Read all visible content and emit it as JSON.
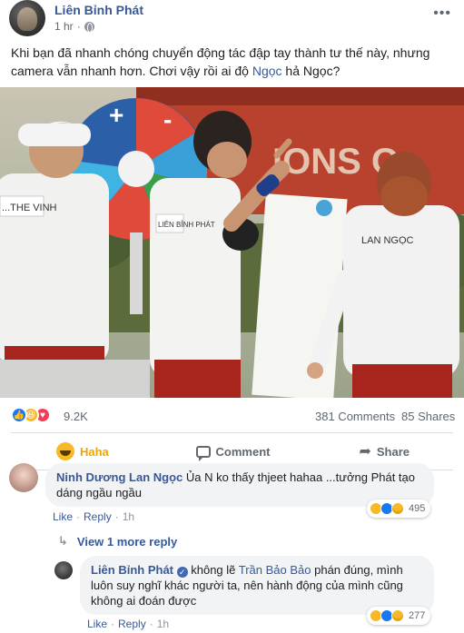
{
  "post": {
    "author": "Liên Bỉnh Phát",
    "time": "1 hr",
    "text_before_mention": "Khi bạn đã nhanh chóng chuyển động tác đập tay thành tư thế này, nhưng camera vẫn nhanh hơn. Chơi vậy rồi ai độ ",
    "mention": "Ngọc",
    "text_after_mention": " hả Ngọc?"
  },
  "photo": {
    "shirt_labels": [
      "...THE VINH",
      "LIÊN BỈNH PHÁT",
      "LAN NGỌC"
    ],
    "wall_text": "IONS O"
  },
  "stats": {
    "reactions": "9.2K",
    "comments": "381 Comments",
    "shares": "85 Shares"
  },
  "actions": {
    "haha": "Haha",
    "comment": "Comment",
    "share": "Share"
  },
  "comments": [
    {
      "author": "Ninh Dương Lan Ngọc",
      "text": "Ủa N ko thấy thjeet hahaa ...tưởng Phát tạo dáng ngầu ngầu",
      "like": "Like",
      "reply": "Reply",
      "time": "1h",
      "reaction_count": "495"
    }
  ],
  "view_more": "View 1 more reply",
  "reply": {
    "author": "Liên Bỉnh Phát",
    "text_before_mention": " không lẽ ",
    "mention": "Trần Bảo Bảo",
    "text_after_mention": " phán đúng, mình luôn suy nghĩ khác người ta, nên hành động của mình cũng không ai đoán được",
    "like": "Like",
    "reply": "Reply",
    "time": "1h",
    "reaction_count": "277"
  },
  "colors": {
    "link": "#385898",
    "haha": "#f7b928",
    "like": "#1877f2",
    "love": "#f33e58"
  }
}
